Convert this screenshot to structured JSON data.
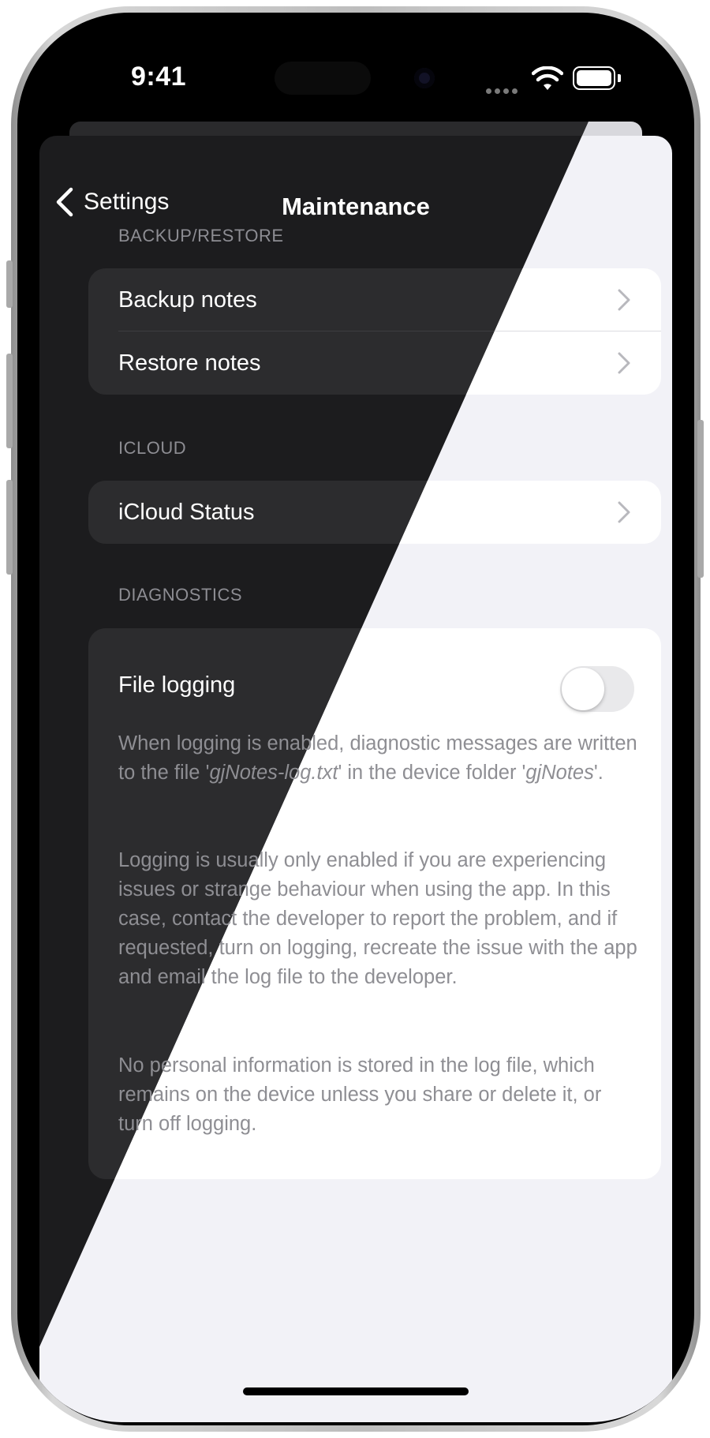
{
  "status_bar": {
    "time": "9:41"
  },
  "nav": {
    "back_label": "Settings",
    "title": "Maintenance"
  },
  "sections": {
    "backup": {
      "header": "BACKUP/RESTORE",
      "rows": [
        "Backup notes",
        "Restore notes"
      ]
    },
    "icloud": {
      "header": "ICLOUD",
      "rows": [
        "iCloud Status"
      ]
    },
    "diagnostics": {
      "header": "DIAGNOSTICS",
      "toggle_label": "File logging",
      "toggle_on": false,
      "para1": {
        "part1": "When logging is enabled, diagnostic messages are written to the file '",
        "filename": "gjNotes-log.txt",
        "part2": "' in the device folder '",
        "folder": "gjNotes",
        "part3": "'."
      },
      "para2": "Logging is usually only enabled if you are experiencing issues or strange behaviour when using the app. In this case, contact the developer to report the problem, and if requested, turn on logging, recreate the issue with the app and email the log file to the developer.",
      "para3": "No personal information is stored in the log file, which remains on the device unless you share or delete it, or turn off logging."
    }
  },
  "colors": {
    "dark_background": "#1c1c1e",
    "dark_cell": "#2c2c2e",
    "light_background": "#f2f2f7",
    "light_cell": "#ffffff",
    "secondary_text": "#8e8e93"
  }
}
